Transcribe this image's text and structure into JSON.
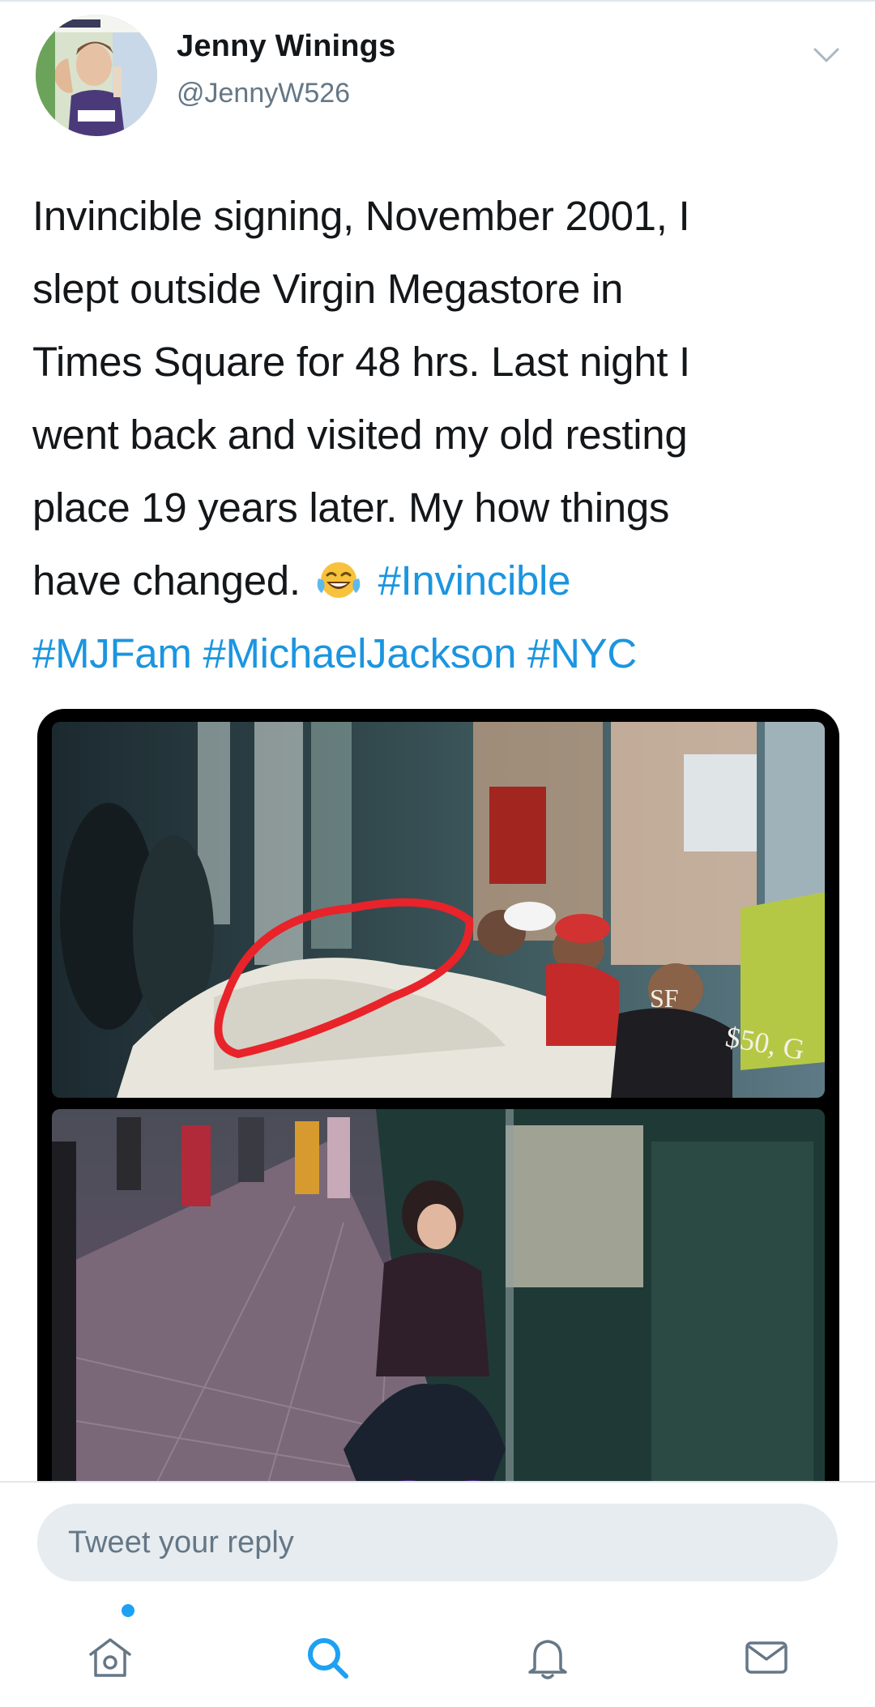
{
  "tweet": {
    "author": {
      "name": "Jenny Winings",
      "handle": "@JennyW526"
    },
    "text": {
      "line1": "Invincible signing, November 2001, I",
      "line2": "slept outside Virgin Megastore in",
      "line3": "Times Square for 48 hrs. Last night I",
      "line4": "went back and visited my old resting",
      "line5": "place 19 years later. My how things",
      "line6_plain": "have changed.",
      "emoji": "face-with-tears-of-joy",
      "hashtags": [
        "#Invincible",
        "#MJFam",
        "#MichaelJackson",
        "#NYC"
      ]
    },
    "media": {
      "photo_top": {
        "signage_letters": "SF",
        "signage_price": "$50, G",
        "circle_annotation_color": "#e8232a"
      },
      "photo_bottom": {}
    }
  },
  "reply": {
    "placeholder": "Tweet your reply"
  },
  "tabs": [
    {
      "name": "home",
      "icon": "home-icon",
      "has_badge": true
    },
    {
      "name": "search",
      "icon": "search-icon",
      "active": true
    },
    {
      "name": "notifications",
      "icon": "bell-icon"
    },
    {
      "name": "messages",
      "icon": "envelope-icon"
    }
  ],
  "colors": {
    "link": "#1b95e0",
    "text": "#14171a",
    "secondary": "#657786",
    "reply_bg": "#e6ecf0",
    "divider": "#e1e8ed",
    "badge": "#1da1f2"
  }
}
